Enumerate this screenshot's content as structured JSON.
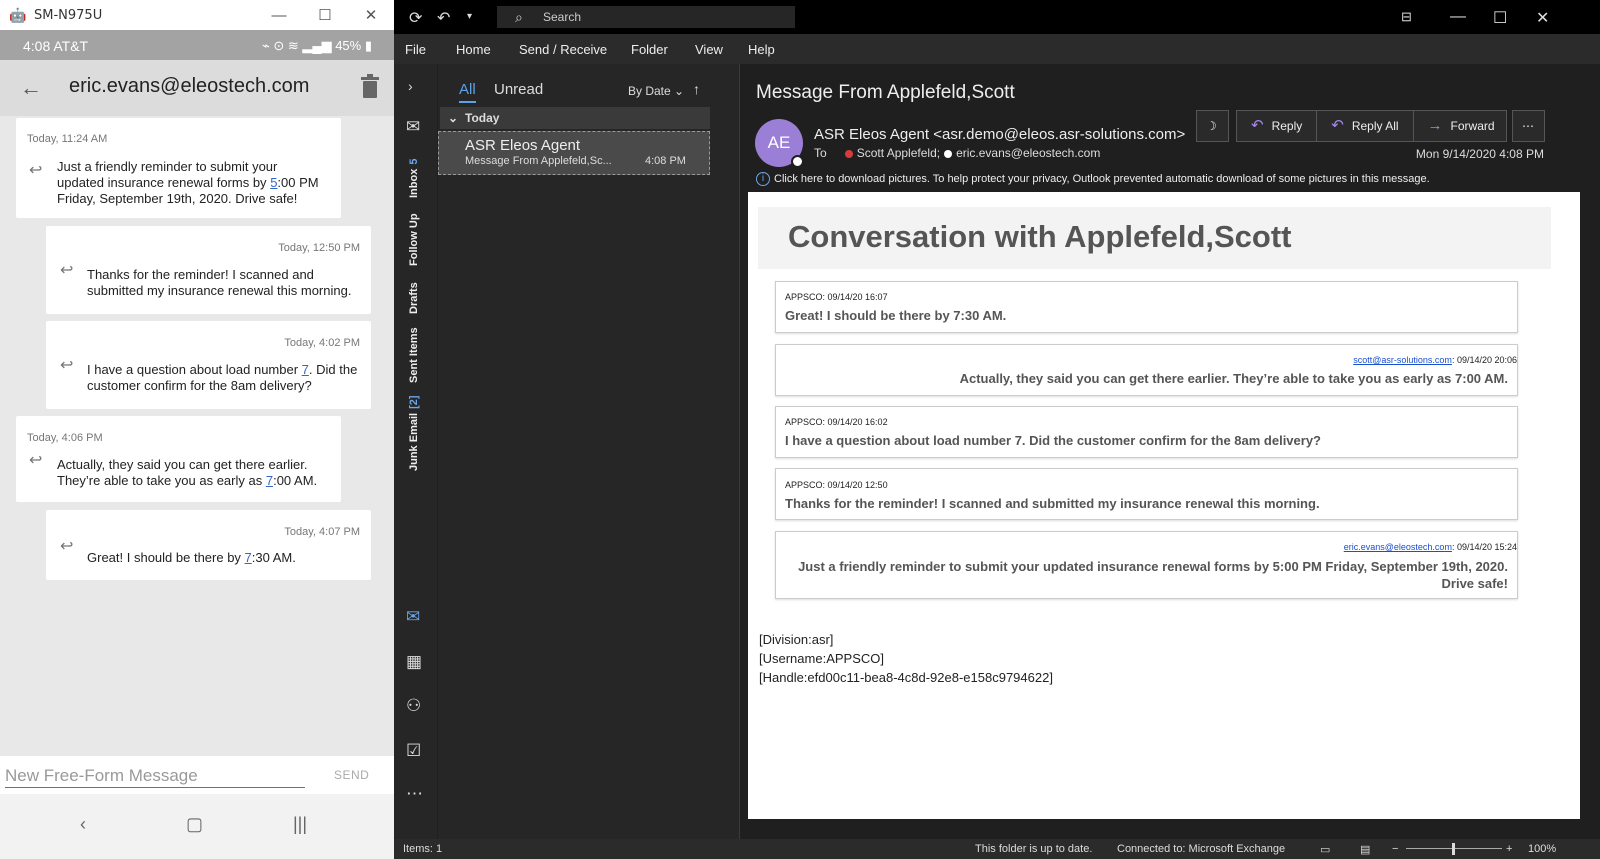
{
  "phone": {
    "window_title": "SM-N975U",
    "status_left": "4:08 AT&T",
    "status_right": "45%",
    "contact": "eric.evans@eleostech.com",
    "messages": [
      {
        "time": "Today, 11:24 AM",
        "pre": "Just a friendly reminder to submit your updated insurance renewal forms by ",
        "link": "5",
        "post": ":00 PM Friday, September 19th, 2020.  Drive safe!"
      },
      {
        "time": "Today, 12:50 PM",
        "pre": "Thanks for the reminder!  I scanned and submitted my insurance renewal this morning.",
        "link": "",
        "post": ""
      },
      {
        "time": "Today, 4:02 PM",
        "pre": "I have a question about load number ",
        "link": "7",
        "post": ".  Did the customer confirm for the 8am delivery?"
      },
      {
        "time": "Today, 4:06 PM",
        "pre": "Actually, they said you can get there earlier.  They’re able to take you as early as ",
        "link": "7",
        "post": ":00 AM."
      },
      {
        "time": "Today, 4:07 PM",
        "pre": "Great!  I should be there by ",
        "link": "7",
        "post": ":30 AM."
      }
    ],
    "input_placeholder": "New Free-Form Message",
    "send_label": "SEND"
  },
  "outlook": {
    "search_label": "Search",
    "menu": [
      "File",
      "Home",
      "Send / Receive",
      "Folder",
      "View",
      "Help"
    ],
    "rail": {
      "inbox": "Inbox",
      "inbox_count": "5",
      "follow_up": "Follow Up",
      "drafts": "Drafts",
      "sent": "Sent Items",
      "junk": "Junk Email",
      "junk_count": "[2]"
    },
    "list": {
      "tab_all": "All",
      "tab_unread": "Unread",
      "sort": "By Date",
      "group": "Today",
      "item_from": "ASR Eleos Agent",
      "item_subject": "Message From Applefeld,Sc...",
      "item_time": "4:08 PM"
    },
    "reading": {
      "subject": "Message From Applefeld,Scott",
      "avatar": "AE",
      "sender": "ASR Eleos Agent <asr.demo@eleos.asr-solutions.com>",
      "to_label": "To",
      "to_1": "Scott Applefeld;",
      "to_2": "eric.evans@eleostech.com",
      "date": "Mon 9/14/2020 4:08 PM",
      "reply": "Reply",
      "reply_all": "Reply All",
      "forward": "Forward",
      "info": "Click here to download pictures. To help protect your privacy, Outlook prevented automatic download of some pictures in this message.",
      "heading": "Conversation with Applefeld,Scott",
      "thread": [
        {
          "meta": "APPSCO: 09/14/20 16:07",
          "link": "",
          "text": "Great! I should be there by 7:30 AM.",
          "align": "left"
        },
        {
          "meta": ": 09/14/20 20:06",
          "link": "scott@asr-solutions.com",
          "text": "Actually, they said you can get there earlier.  They’re able to take you as early as 7:00 AM.",
          "align": "right"
        },
        {
          "meta": "APPSCO: 09/14/20 16:02",
          "link": "",
          "text": "I have a question about load number 7. Did the customer confirm for the 8am delivery?",
          "align": "left"
        },
        {
          "meta": "APPSCO: 09/14/20 12:50",
          "link": "",
          "text": "Thanks for the reminder! I scanned and submitted my insurance renewal this morning.",
          "align": "left"
        },
        {
          "meta": ": 09/14/20 15:24",
          "link": "eric.evans@eleostech.com",
          "text": "Just a friendly reminder to submit your updated insurance renewal forms by 5:00 PM Friday, September 19th, 2020. Drive safe!",
          "align": "right"
        }
      ],
      "division": "[Division:asr]",
      "username": "[Username:APPSCO]",
      "handle": "[Handle:efd00c11-bea8-4c8d-92e8-e158c9794622]"
    },
    "statusbar": {
      "items": "Items: 1",
      "uptodate": "This folder is up to date.",
      "connected": "Connected to: Microsoft Exchange",
      "zoom": "100%"
    }
  }
}
